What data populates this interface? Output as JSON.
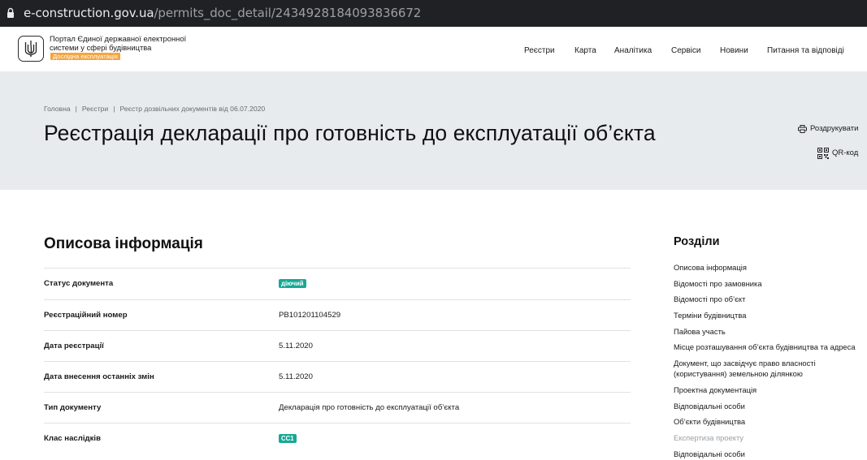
{
  "browser": {
    "url_host": "e-construction.gov.ua",
    "url_path": "/permits_doc_detail/2434928184093836672"
  },
  "header": {
    "portal_title": "Портал Єдиної державної електронної системи у сфері будівництва",
    "beta_badge": "Дослідна експлуатація",
    "nav": [
      "Реєстри",
      "Карта",
      "Аналітика",
      "Сервіси",
      "Новини",
      "Питання та відповіді"
    ]
  },
  "hero": {
    "breadcrumbs": [
      "Головна",
      "Реєстри",
      "Реєстр дозвільних документів від 06.07.2020"
    ],
    "title": "Реєстрація декларації про готовність до експлуатації об’єкта",
    "print_label": "Роздрукувати",
    "qr_label": "QR-код"
  },
  "main": {
    "section_title": "Описова інформація",
    "rows": [
      {
        "label": "Статус документа",
        "value": "діючий",
        "type": "tag"
      },
      {
        "label": "Реєстраційний номер",
        "value": "РВ101201104529",
        "type": "text"
      },
      {
        "label": "Дата реєстрації",
        "value": "5.11.2020",
        "type": "text"
      },
      {
        "label": "Дата внесення останніх змін",
        "value": "5.11.2020",
        "type": "text"
      },
      {
        "label": "Тип документу",
        "value": "Декларація про готовність до експлуатації об’єкта",
        "type": "text"
      },
      {
        "label": "Клас наслідків",
        "value": "СС1",
        "type": "tag"
      }
    ]
  },
  "sidebar": {
    "title": "Розділи",
    "items": [
      "Описова інформація",
      "Відомості про замовника",
      "Відомості про об’єкт",
      "Терміни будівництва",
      "Пайова участь",
      "Місце розташування об’єкта будівництва та адреса",
      "Документ, що засвідчує право власності (користування) земельною ділянкою",
      "Проектна документація",
      "Відповідальні особи",
      "Об’єкти будівництва",
      "Експертиза проекту",
      "Відповідальні особи"
    ],
    "muted_index": 10
  },
  "colors": {
    "hero_bg": "#e7ebee",
    "tag_bg": "#17a895",
    "badge_bg": "#f3a641",
    "addressbar_bg": "#202124"
  }
}
